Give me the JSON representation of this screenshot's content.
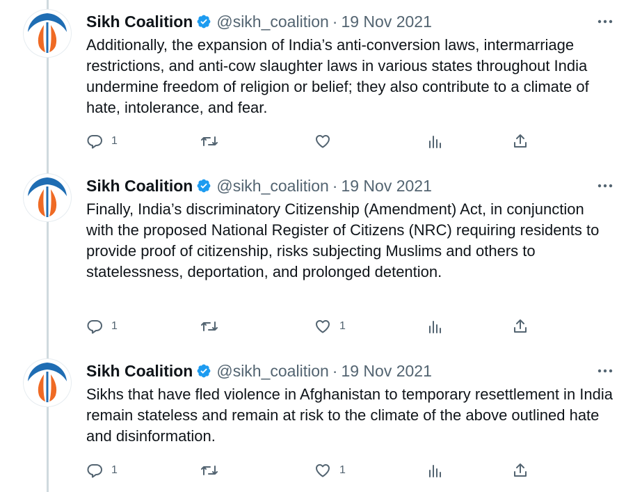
{
  "colors": {
    "verified_badge": "#1d9bf0",
    "secondary_text": "#536471",
    "thread_line": "#cfd9de",
    "avatar_blue": "#1f6db3",
    "avatar_orange": "#ef6a24"
  },
  "tweets": [
    {
      "author": "Sikh Coalition",
      "handle": "@sikh_coalition",
      "separator": "·",
      "date": "19 Nov 2021",
      "text": "Additionally, the expansion of India’s anti-conversion laws, intermarriage restrictions, and anti-cow slaughter laws in various states throughout India undermine freedom of religion or belief; they also contribute to a climate of hate, intolerance, and fear.",
      "reply_count": "1",
      "retweet_count": "",
      "like_count": ""
    },
    {
      "author": "Sikh Coalition",
      "handle": "@sikh_coalition",
      "separator": "·",
      "date": "19 Nov 2021",
      "text": "Finally, India’s discriminatory Citizenship (Amendment) Act, in conjunction with the proposed National Register of Citizens (NRC) requiring residents to provide proof of citizenship, risks subjecting Muslims and others to statelessness, deportation, and prolonged detention.",
      "reply_count": "1",
      "retweet_count": "",
      "like_count": "1"
    },
    {
      "author": "Sikh Coalition",
      "handle": "@sikh_coalition",
      "separator": "·",
      "date": "19 Nov 2021",
      "text": "Sikhs that have fled violence in Afghanistan to temporary resettlement in India remain stateless and remain at risk to the climate of the above outlined hate and disinformation.",
      "reply_count": "1",
      "retweet_count": "",
      "like_count": "1"
    }
  ],
  "icons": {
    "more": "more-horizontal-icon",
    "reply": "reply-bubble-icon",
    "retweet": "retweet-icon",
    "like": "heart-icon",
    "views": "views-bar-chart-icon",
    "share": "share-upload-icon",
    "verified": "verified-badge-icon"
  }
}
